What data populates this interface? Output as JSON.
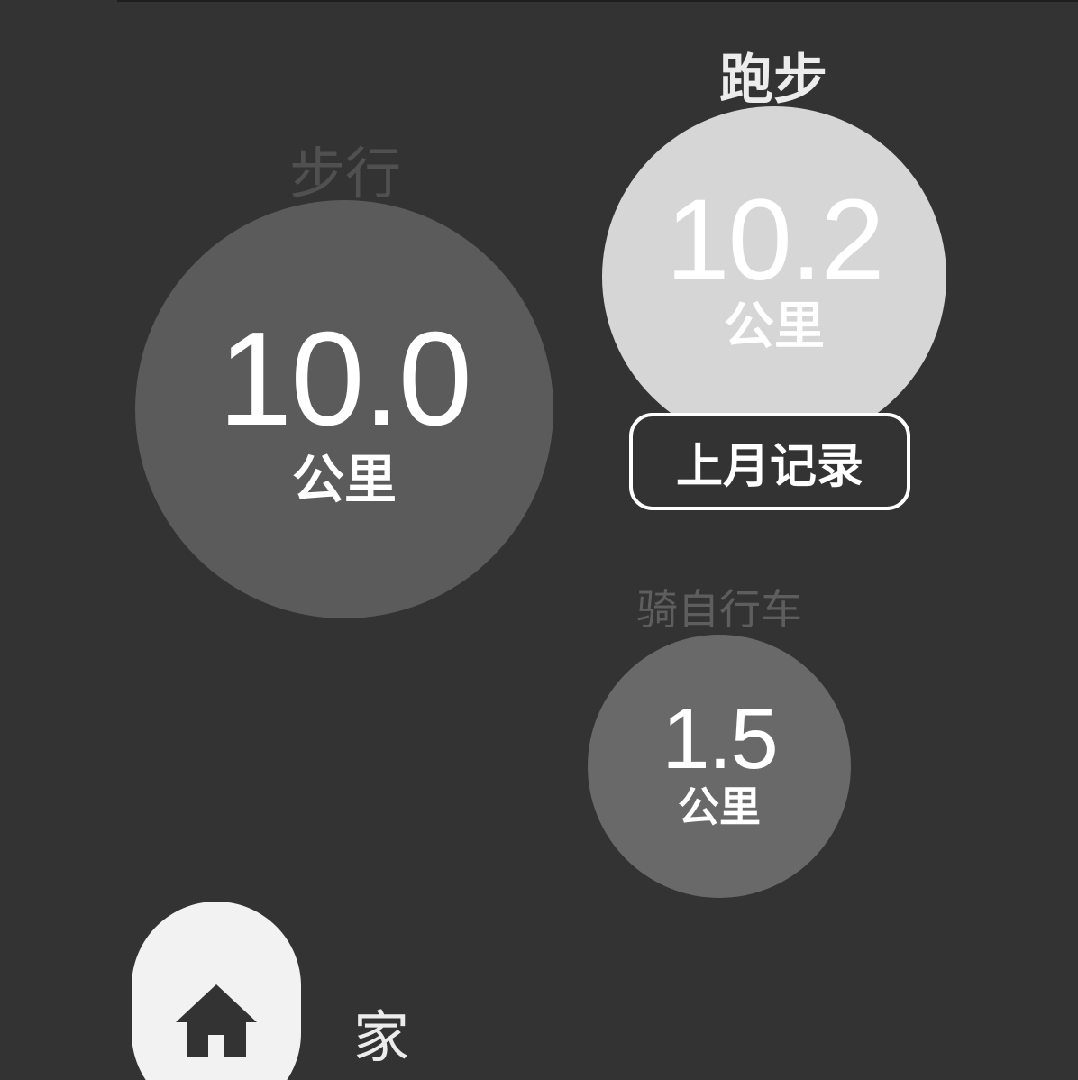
{
  "activities": {
    "walk": {
      "label": "步行",
      "value": "10.0",
      "unit": "公里"
    },
    "run": {
      "label": "跑步",
      "value": "10.2",
      "unit": "公里",
      "history_button": "上月记录"
    },
    "bike": {
      "label": "骑自行车",
      "value": "1.5",
      "unit": "公里"
    }
  },
  "nav": {
    "home_icon": "home-icon",
    "home_label": "家"
  },
  "colors": {
    "background": "#333333",
    "walk_circle": "#5b5b5b",
    "run_circle": "#d6d6d6",
    "bike_circle": "#696969",
    "home_button": "#f2f2f2"
  }
}
